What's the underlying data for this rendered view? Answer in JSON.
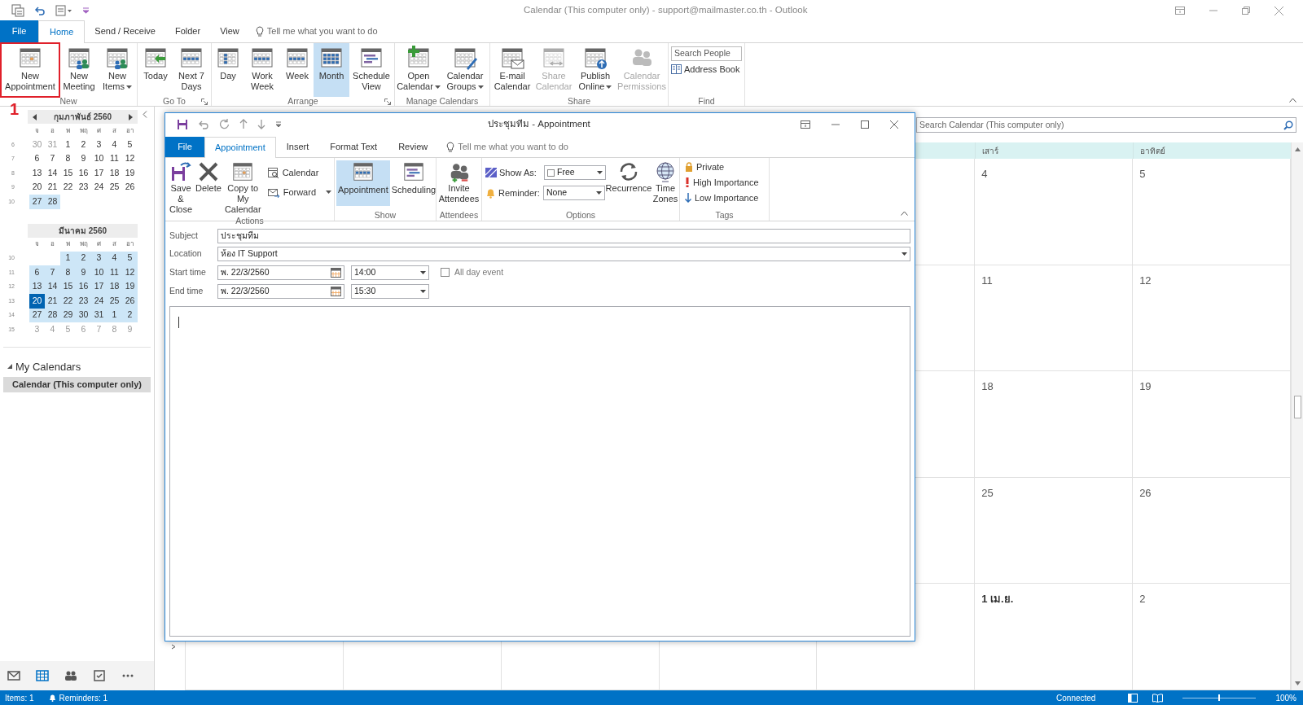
{
  "window": {
    "title": "Calendar (This computer only) - support@mailmaster.co.th  -  Outlook"
  },
  "tabs": [
    {
      "label": "File",
      "kind": "file",
      "selected": false
    },
    {
      "label": "Home",
      "kind": "tab",
      "selected": true
    },
    {
      "label": "Send / Receive",
      "kind": "tab",
      "selected": false
    },
    {
      "label": "Folder",
      "kind": "tab",
      "selected": false
    },
    {
      "label": "View",
      "kind": "tab",
      "selected": false
    }
  ],
  "tell_me": "Tell me what you want to do",
  "ribbon": [
    {
      "label": "New",
      "launcher": false,
      "buttons": [
        {
          "label": "New Appointment",
          "selected": false,
          "disabled": false,
          "dropdown": false,
          "annotated": true
        },
        {
          "label": "New Meeting",
          "selected": false,
          "disabled": false,
          "dropdown": false,
          "annotated": false
        },
        {
          "label": "New Items",
          "selected": false,
          "disabled": false,
          "dropdown": true,
          "annotated": false
        }
      ]
    },
    {
      "label": "Go To",
      "launcher": true,
      "buttons": [
        {
          "label": "Today",
          "selected": false,
          "disabled": false,
          "dropdown": false,
          "annotated": false
        },
        {
          "label": "Next 7 Days",
          "selected": false,
          "disabled": false,
          "dropdown": false,
          "annotated": false
        }
      ]
    },
    {
      "label": "Arrange",
      "launcher": true,
      "buttons": [
        {
          "label": "Day",
          "selected": false,
          "disabled": false,
          "dropdown": false,
          "annotated": false
        },
        {
          "label": "Work Week",
          "selected": false,
          "disabled": false,
          "dropdown": false,
          "annotated": false
        },
        {
          "label": "Week",
          "selected": false,
          "disabled": false,
          "dropdown": false,
          "annotated": false
        },
        {
          "label": "Month",
          "selected": true,
          "disabled": false,
          "dropdown": false,
          "annotated": false
        },
        {
          "label": "Schedule View",
          "selected": false,
          "disabled": false,
          "dropdown": false,
          "annotated": false
        }
      ]
    },
    {
      "label": "Manage Calendars",
      "launcher": false,
      "buttons": [
        {
          "label": "Open Calendar",
          "selected": false,
          "disabled": false,
          "dropdown": true,
          "annotated": false
        },
        {
          "label": "Calendar Groups",
          "selected": false,
          "disabled": false,
          "dropdown": true,
          "annotated": false
        }
      ]
    },
    {
      "label": "Share",
      "launcher": false,
      "buttons": [
        {
          "label": "E-mail Calendar",
          "selected": false,
          "disabled": false,
          "dropdown": false,
          "annotated": false
        },
        {
          "label": "Share Calendar",
          "selected": false,
          "disabled": true,
          "dropdown": false,
          "annotated": false
        },
        {
          "label": "Publish Online",
          "selected": false,
          "disabled": false,
          "dropdown": true,
          "annotated": false
        },
        {
          "label": "Calendar Permissions",
          "selected": false,
          "disabled": true,
          "dropdown": false,
          "annotated": false
        }
      ]
    }
  ],
  "find": {
    "label": "Find",
    "search_placeholder": "Search People",
    "address_book": "Address Book"
  },
  "annotation": "1",
  "sidebar": {
    "months": [
      {
        "title": "กุมภาพันธ์ 2560",
        "nav": true,
        "weekdays": [
          "จ",
          "อ",
          "พ",
          "พฤ",
          "ศ",
          "ส",
          "อา"
        ],
        "weeks": [
          {
            "number": "6",
            "in_view": false,
            "days": [
              {
                "d": "30",
                "muted": true,
                "today": false
              },
              {
                "d": "31",
                "muted": true,
                "today": false
              },
              {
                "d": "1",
                "muted": false,
                "today": false
              },
              {
                "d": "2",
                "muted": false,
                "today": false
              },
              {
                "d": "3",
                "muted": false,
                "today": false
              },
              {
                "d": "4",
                "muted": false,
                "today": false
              },
              {
                "d": "5",
                "muted": false,
                "today": false
              }
            ]
          },
          {
            "number": "7",
            "in_view": false,
            "days": [
              {
                "d": "6",
                "muted": false,
                "today": false
              },
              {
                "d": "7",
                "muted": false,
                "today": false
              },
              {
                "d": "8",
                "muted": false,
                "today": false
              },
              {
                "d": "9",
                "muted": false,
                "today": false
              },
              {
                "d": "10",
                "muted": false,
                "today": false
              },
              {
                "d": "11",
                "muted": false,
                "today": false
              },
              {
                "d": "12",
                "muted": false,
                "today": false
              }
            ]
          },
          {
            "number": "8",
            "in_view": false,
            "days": [
              {
                "d": "13",
                "muted": false,
                "today": false
              },
              {
                "d": "14",
                "muted": false,
                "today": false
              },
              {
                "d": "15",
                "muted": false,
                "today": false
              },
              {
                "d": "16",
                "muted": false,
                "today": false
              },
              {
                "d": "17",
                "muted": false,
                "today": false
              },
              {
                "d": "18",
                "muted": false,
                "today": false
              },
              {
                "d": "19",
                "muted": false,
                "today": false
              }
            ]
          },
          {
            "number": "9",
            "in_view": false,
            "days": [
              {
                "d": "20",
                "muted": false,
                "today": false
              },
              {
                "d": "21",
                "muted": false,
                "today": false
              },
              {
                "d": "22",
                "muted": false,
                "today": false
              },
              {
                "d": "23",
                "muted": false,
                "today": false
              },
              {
                "d": "24",
                "muted": false,
                "today": false
              },
              {
                "d": "25",
                "muted": false,
                "today": false
              },
              {
                "d": "26",
                "muted": false,
                "today": false
              }
            ]
          },
          {
            "number": "10",
            "in_view": true,
            "days": [
              {
                "d": "27",
                "muted": false,
                "today": false
              },
              {
                "d": "28",
                "muted": false,
                "today": false
              }
            ]
          }
        ]
      },
      {
        "title": "มีนาคม 2560",
        "nav": false,
        "weekdays": [
          "จ",
          "อ",
          "พ",
          "พฤ",
          "ศ",
          "ส",
          "อา"
        ],
        "weeks": [
          {
            "number": "10",
            "in_view": true,
            "days": [
              {
                "d": "1",
                "muted": false,
                "today": false
              },
              {
                "d": "2",
                "muted": false,
                "today": false
              },
              {
                "d": "3",
                "muted": false,
                "today": false
              },
              {
                "d": "4",
                "muted": false,
                "today": false
              },
              {
                "d": "5",
                "muted": false,
                "today": false
              }
            ]
          },
          {
            "number": "11",
            "in_view": true,
            "days": [
              {
                "d": "6",
                "muted": false,
                "today": false
              },
              {
                "d": "7",
                "muted": false,
                "today": false
              },
              {
                "d": "8",
                "muted": false,
                "today": false
              },
              {
                "d": "9",
                "muted": false,
                "today": false
              },
              {
                "d": "10",
                "muted": false,
                "today": false
              },
              {
                "d": "11",
                "muted": false,
                "today": false
              },
              {
                "d": "12",
                "muted": false,
                "today": false
              }
            ]
          },
          {
            "number": "12",
            "in_view": true,
            "days": [
              {
                "d": "13",
                "muted": false,
                "today": false
              },
              {
                "d": "14",
                "muted": false,
                "today": false
              },
              {
                "d": "15",
                "muted": false,
                "today": false
              },
              {
                "d": "16",
                "muted": false,
                "today": false
              },
              {
                "d": "17",
                "muted": false,
                "today": false
              },
              {
                "d": "18",
                "muted": false,
                "today": false
              },
              {
                "d": "19",
                "muted": false,
                "today": false
              }
            ]
          },
          {
            "number": "13",
            "in_view": true,
            "days": [
              {
                "d": "20",
                "muted": false,
                "today": true
              },
              {
                "d": "21",
                "muted": false,
                "today": false
              },
              {
                "d": "22",
                "muted": false,
                "today": false
              },
              {
                "d": "23",
                "muted": false,
                "today": false
              },
              {
                "d": "24",
                "muted": false,
                "today": false
              },
              {
                "d": "25",
                "muted": false,
                "today": false
              },
              {
                "d": "26",
                "muted": false,
                "today": false
              }
            ]
          },
          {
            "number": "14",
            "in_view": true,
            "days": [
              {
                "d": "27",
                "muted": false,
                "today": false
              },
              {
                "d": "28",
                "muted": false,
                "today": false
              },
              {
                "d": "29",
                "muted": false,
                "today": false
              },
              {
                "d": "30",
                "muted": false,
                "today": false
              },
              {
                "d": "31",
                "muted": false,
                "today": false
              },
              {
                "d": "1",
                "muted": false,
                "today": false
              },
              {
                "d": "2",
                "muted": false,
                "today": false
              }
            ]
          },
          {
            "number": "15",
            "in_view": false,
            "days": [
              {
                "d": "3",
                "muted": true,
                "today": false
              },
              {
                "d": "4",
                "muted": true,
                "today": false
              },
              {
                "d": "5",
                "muted": true,
                "today": false
              },
              {
                "d": "6",
                "muted": true,
                "today": false
              },
              {
                "d": "7",
                "muted": true,
                "today": false
              },
              {
                "d": "8",
                "muted": true,
                "today": false
              },
              {
                "d": "9",
                "muted": true,
                "today": false
              }
            ]
          }
        ]
      }
    ],
    "folders": {
      "title": "My Calendars",
      "expanded": true,
      "items": [
        {
          "label": "Calendar (This computer only)",
          "selected": true
        }
      ]
    },
    "nav": [
      {
        "selected": false
      },
      {
        "selected": true
      },
      {
        "selected": false
      },
      {
        "selected": false
      },
      {
        "selected": false
      }
    ]
  },
  "calendar": {
    "search_placeholder": "Search Calendar (This computer only)",
    "headers": [
      "เสาร์",
      "อาทิตย์"
    ],
    "weeks": [
      {
        "days": [
          {
            "d": "4",
            "month_start": false
          },
          {
            "d": "5",
            "month_start": false
          }
        ]
      },
      {
        "days": [
          {
            "d": "11",
            "month_start": false
          },
          {
            "d": "12",
            "month_start": false
          }
        ]
      },
      {
        "days": [
          {
            "d": "18",
            "month_start": false
          },
          {
            "d": "19",
            "month_start": false
          }
        ]
      },
      {
        "days": [
          {
            "d": "25",
            "month_start": false
          },
          {
            "d": "26",
            "month_start": false
          }
        ]
      },
      {
        "days": [
          {
            "d": "1 เม.ย.",
            "month_start": true
          },
          {
            "d": "2",
            "month_start": false
          }
        ]
      }
    ]
  },
  "appointment": {
    "title": "ประชุมทีม  -  Appointment",
    "tabs": [
      {
        "label": "File",
        "kind": "file",
        "selected": false
      },
      {
        "label": "Appointment",
        "kind": "tab",
        "selected": true
      },
      {
        "label": "Insert",
        "kind": "tab",
        "selected": false
      },
      {
        "label": "Format Text",
        "kind": "tab",
        "selected": false
      },
      {
        "label": "Review",
        "kind": "tab",
        "selected": false
      }
    ],
    "tell_me": "Tell me what you want to do",
    "actions": {
      "label": "Actions",
      "buttons": [
        "Save & Close",
        "Delete",
        "Copy to My Calendar"
      ],
      "small": [
        {
          "label": "Calendar",
          "dropdown": false
        },
        {
          "label": "Forward",
          "dropdown": true
        }
      ]
    },
    "show": {
      "label": "Show",
      "buttons": [
        {
          "label": "Appointment",
          "selected": true
        },
        {
          "label": "Scheduling",
          "selected": false
        }
      ]
    },
    "attendees": {
      "label": "Attendees",
      "button": "Invite Attendees"
    },
    "options": {
      "label": "Options",
      "show_as": {
        "label": "Show As:",
        "value": "Free"
      },
      "reminder": {
        "label": "Reminder:",
        "value": "None"
      },
      "buttons": [
        "Recurrence",
        "Time Zones"
      ]
    },
    "tags": {
      "label": "Tags",
      "items": [
        "Private",
        "High Importance",
        "Low Importance"
      ]
    },
    "form": {
      "subject": {
        "label": "Subject",
        "value": "ประชุมทีม"
      },
      "location": {
        "label": "Location",
        "value": "ห้อง IT Support"
      },
      "start": {
        "label": "Start time",
        "date": "พ. 22/3/2560",
        "time": "14:00"
      },
      "end": {
        "label": "End time",
        "date": "พ. 22/3/2560",
        "time": "15:30"
      },
      "all_day": {
        "label": "All day event",
        "checked": false
      }
    }
  },
  "status_bar": {
    "items": "Items: 1",
    "reminders": "Reminders: 1",
    "connection": "Connected",
    "zoom_slider": {
      "level": 0.5
    },
    "zoom": "100%"
  }
}
